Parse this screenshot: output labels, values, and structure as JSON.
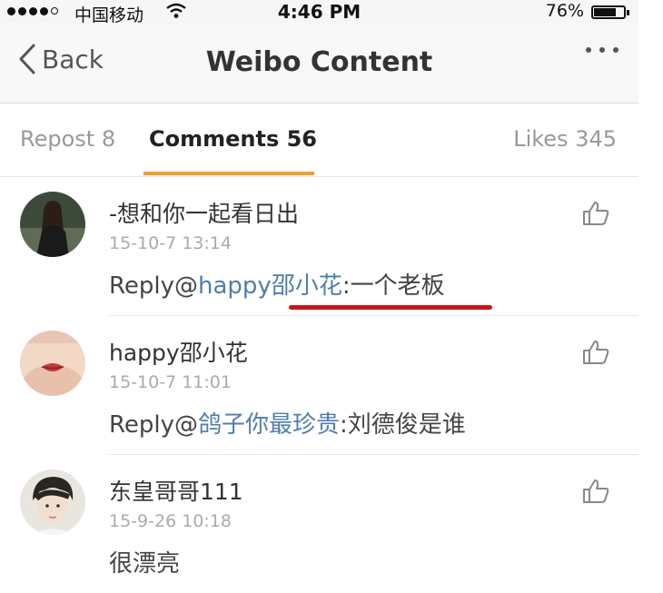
{
  "status_bar": {
    "carrier": "中国移动",
    "time": "4:46 PM",
    "battery": "76%",
    "battery_level": 0.76
  },
  "nav": {
    "back_label": "Back",
    "title": "Weibo Content"
  },
  "tabs": {
    "repost": "Repost 8",
    "comments": "Comments 56",
    "likes": "Likes 345",
    "active": "comments"
  },
  "comments": [
    {
      "username": "-想和你一起看日出",
      "time": "15-10-7 13:14",
      "prefix": "Reply@",
      "mention": "happy邵小花",
      "body": ":一个老板"
    },
    {
      "username": "happy邵小花",
      "time": "15-10-7 11:01",
      "prefix": "Reply@",
      "mention": "鸽子你最珍贵",
      "body": ":刘德俊是谁"
    },
    {
      "username": "东皇哥哥111",
      "time": "15-9-26 10:18",
      "prefix": "",
      "mention": "",
      "body": "很漂亮"
    }
  ],
  "colors": {
    "accent_tab": "#f0a030",
    "mention": "#507daf",
    "highlight_underline": "#c8161d"
  }
}
